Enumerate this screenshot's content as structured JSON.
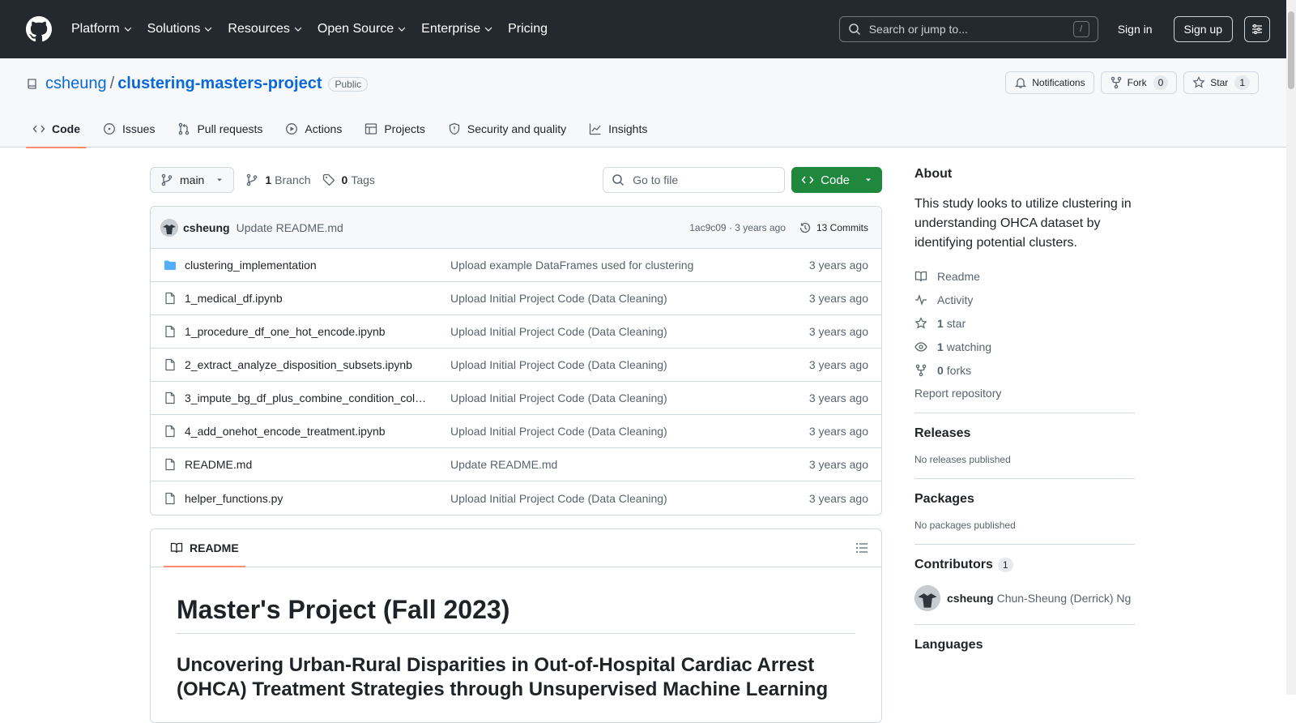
{
  "header": {
    "nav": [
      {
        "label": "Platform"
      },
      {
        "label": "Solutions"
      },
      {
        "label": "Resources"
      },
      {
        "label": "Open Source"
      },
      {
        "label": "Enterprise"
      },
      {
        "label": "Pricing"
      }
    ],
    "search_placeholder": "Search or jump to...",
    "slash_key": "/",
    "signin": "Sign in",
    "signup": "Sign up"
  },
  "repo": {
    "owner": "csheung",
    "separator": "/",
    "name": "clustering-masters-project",
    "visibility": "Public",
    "notifications": "Notifications",
    "fork_label": "Fork",
    "fork_count": "0",
    "star_label": "Star",
    "star_count": "1"
  },
  "tabs": [
    {
      "label": "Code",
      "icon": "code-icon"
    },
    {
      "label": "Issues",
      "icon": "issue-icon"
    },
    {
      "label": "Pull requests",
      "icon": "pull-request-icon"
    },
    {
      "label": "Actions",
      "icon": "play-icon"
    },
    {
      "label": "Projects",
      "icon": "table-icon"
    },
    {
      "label": "Security and quality",
      "icon": "shield-icon"
    },
    {
      "label": "Insights",
      "icon": "graph-icon"
    }
  ],
  "toolbar": {
    "branch": "main",
    "branch_count": "1",
    "branch_label": "Branch",
    "tag_count": "0",
    "tag_label": "Tags",
    "goto_placeholder": "Go to file",
    "code_label": "Code"
  },
  "commit": {
    "author": "csheung",
    "message": "Update README.md",
    "sha_time": "1ac9c09 · 3 years ago",
    "commits": "13 Commits"
  },
  "files": [
    {
      "name": "clustering_implementation",
      "type": "folder",
      "message": "Upload example DataFrames used for clustering",
      "time": "3 years ago"
    },
    {
      "name": "1_medical_df.ipynb",
      "type": "file",
      "message": "Upload Initial Project Code (Data Cleaning)",
      "time": "3 years ago"
    },
    {
      "name": "1_procedure_df_one_hot_encode.ipynb",
      "type": "file",
      "message": "Upload Initial Project Code (Data Cleaning)",
      "time": "3 years ago"
    },
    {
      "name": "2_extract_analyze_disposition_subsets.ipynb",
      "type": "file",
      "message": "Upload Initial Project Code (Data Cleaning)",
      "time": "3 years ago"
    },
    {
      "name": "3_impute_bg_df_plus_combine_condition_col…",
      "type": "file",
      "message": "Upload Initial Project Code (Data Cleaning)",
      "time": "3 years ago"
    },
    {
      "name": "4_add_onehot_encode_treatment.ipynb",
      "type": "file",
      "message": "Upload Initial Project Code (Data Cleaning)",
      "time": "3 years ago"
    },
    {
      "name": "README.md",
      "type": "file",
      "message": "Update README.md",
      "time": "3 years ago"
    },
    {
      "name": "helper_functions.py",
      "type": "file",
      "message": "Upload Initial Project Code (Data Cleaning)",
      "time": "3 years ago"
    }
  ],
  "readme": {
    "tab": "README",
    "h1": "Master's Project (Fall 2023)",
    "h2": "Uncovering Urban-Rural Disparities in Out-of-Hospital Cardiac Arrest (OHCA) Treatment Strategies through Unsupervised Machine Learning"
  },
  "sidebar": {
    "about_title": "About",
    "about_desc": "This study looks to utilize clustering in understanding OHCA dataset by identifying potential clusters.",
    "readme": "Readme",
    "activity": "Activity",
    "stars_count": "1",
    "stars_label": "star",
    "watching_count": "1",
    "watching_label": "watching",
    "forks_count": "0",
    "forks_label": "forks",
    "report": "Report repository",
    "releases_title": "Releases",
    "releases_none": "No releases published",
    "packages_title": "Packages",
    "packages_none": "No packages published",
    "contributors_title": "Contributors",
    "contributors_count": "1",
    "contributor_login": "csheung",
    "contributor_name": "Chun-Sheung (Derrick) Ng",
    "languages_title": "Languages"
  },
  "colors": {
    "header_bg": "#24292f",
    "link": "#0969da",
    "green": "#1f883d",
    "tab_underline": "#fd8c73"
  }
}
